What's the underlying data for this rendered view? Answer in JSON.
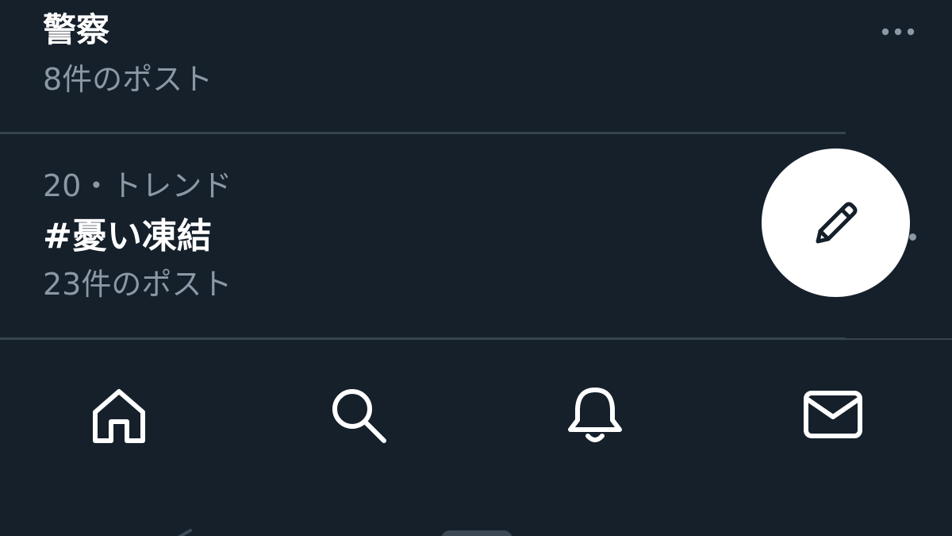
{
  "trends": [
    {
      "title": "警察",
      "post_count": "8件のポスト",
      "more_icon": "more-horizontal-icon"
    },
    {
      "meta": "20・トレンド",
      "title": "#憂い凍結",
      "post_count": "23件のポスト",
      "more_icon": "more-horizontal-icon"
    }
  ],
  "fab": {
    "icon": "pencil-icon"
  },
  "bottom_nav": {
    "tabs": [
      {
        "icon": "home-icon"
      },
      {
        "icon": "search-icon"
      },
      {
        "icon": "bell-icon"
      },
      {
        "icon": "envelope-icon"
      }
    ]
  },
  "colors": {
    "background": "#15202b",
    "primary_text": "#ffffff",
    "secondary_text": "#8b98a5",
    "divider": "#38444d",
    "fab_background": "#ffffff",
    "fab_icon": "#15202b"
  }
}
